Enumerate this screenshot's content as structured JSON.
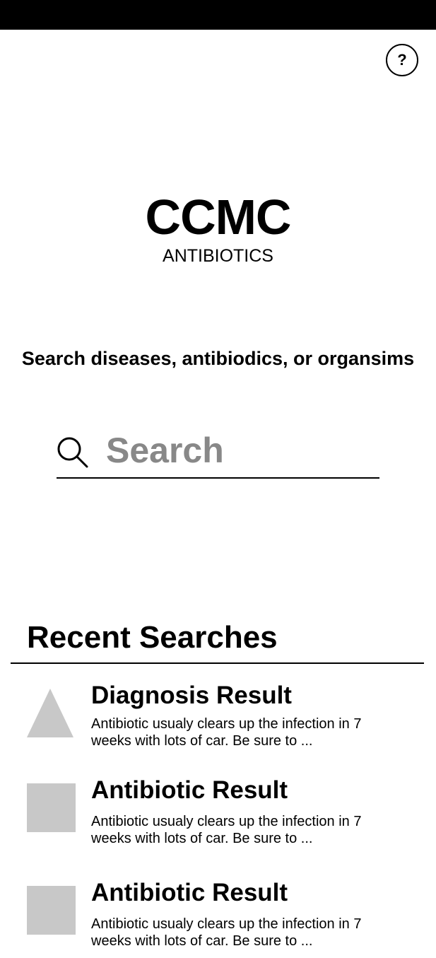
{
  "header": {
    "help_label": "?"
  },
  "logo": {
    "title": "CCMC",
    "subtitle": "ANTIBIOTICS"
  },
  "search": {
    "prompt": "Search diseases, antibiodics, or organsims",
    "placeholder": "Search"
  },
  "recent": {
    "heading": "Recent Searches",
    "items": [
      {
        "icon": "triangle-thumbnail",
        "title": "Diagnosis Result",
        "desc": "Antibiotic usualy clears up the infection in 7 weeks with lots of car. Be sure to ..."
      },
      {
        "icon": "square-thumbnail",
        "title": "Antibiotic Result",
        "desc": "Antibiotic usualy clears up the infection in 7 weeks with lots of car. Be sure to ..."
      },
      {
        "icon": "square-thumbnail",
        "title": "Antibiotic Result",
        "desc": "Antibiotic usualy clears up the infection in 7 weeks with lots of car. Be sure to ..."
      }
    ]
  },
  "colors": {
    "thumbnail": "#c8c8c8",
    "placeholder": "#888888",
    "status_bar": "#000000"
  }
}
